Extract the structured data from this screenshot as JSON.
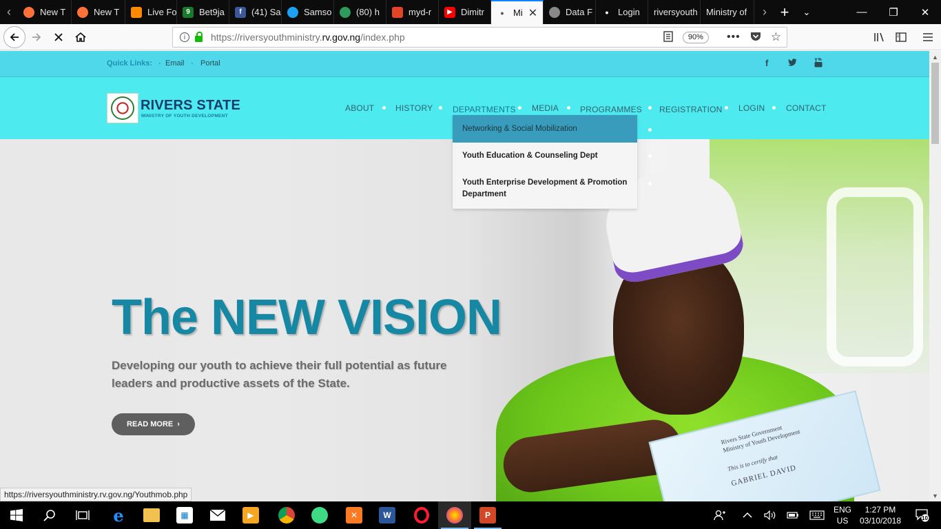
{
  "browser": {
    "tabs": [
      {
        "label": "New T",
        "icon": "firefox-icon",
        "color": "#ff7139"
      },
      {
        "label": "New T",
        "icon": "firefox-icon",
        "color": "#ff7139"
      },
      {
        "label": "Live Fo",
        "icon": "livescore-icon",
        "color": "#ff8a00"
      },
      {
        "label": "Bet9ja",
        "icon": "bet9ja-icon",
        "color": "#1a7a2c"
      },
      {
        "label": "(41) Sa",
        "icon": "facebook-icon",
        "color": "#3b5998"
      },
      {
        "label": "Samso",
        "icon": "twitter-icon",
        "color": "#1da1f2"
      },
      {
        "label": "(80) h",
        "icon": "chat-icon",
        "color": "#2e9b5d"
      },
      {
        "label": "myd-r",
        "icon": "gitlab-icon",
        "color": "#e24329"
      },
      {
        "label": "Dimitr",
        "icon": "youtube-icon",
        "color": "#ff0000"
      },
      {
        "label": "Mi",
        "icon": "loading-dot-icon",
        "color": "#f9f9fa"
      },
      {
        "label": "Data F",
        "icon": "crest-icon",
        "color": "#888888"
      },
      {
        "label": "Login",
        "icon": "loading-dot-icon",
        "color": "#0c0c0d"
      },
      {
        "label": "riversyouth",
        "icon": "",
        "color": "#0c0c0d"
      },
      {
        "label": "Ministry of",
        "icon": "",
        "color": "#0c0c0d"
      }
    ],
    "url_prefix": "https://riversyouthministry.",
    "url_host": "rv.gov.ng",
    "url_suffix": "/index.php",
    "zoom": "90%",
    "status_url": "https://riversyouthministry.rv.gov.ng/Youthmob.php"
  },
  "quickbar": {
    "label": "Quick Links:",
    "links": [
      "Email",
      "Portal"
    ],
    "social": {
      "facebook": "f",
      "twitter": "t",
      "youtube": "▶"
    }
  },
  "brand": {
    "title": "RIVERS STATE",
    "subtitle": "MINISTRY OF YOUTH DEVELOPMENT"
  },
  "nav": {
    "items": [
      "ABOUT",
      "HISTORY",
      "DEPARTMENTS",
      "MEDIA",
      "PROGRAMMES",
      "REGISTRATION",
      "LOGIN",
      "CONTACT"
    ]
  },
  "dropdown": {
    "items": [
      "Networking & Social Mobilization",
      "Youth Education & Counseling Dept",
      "Youth Enterprise Development & Promotion Department"
    ]
  },
  "hero": {
    "title": "The NEW VISION",
    "subtitle": "Developing our youth to achieve their full potential as future leaders and productive assets of the State.",
    "button": "READ MORE"
  },
  "certificate": {
    "line1": "Rivers State Government",
    "line2": "Ministry of Youth Development",
    "line3": "This is to certify that",
    "name": "GABRIEL DAVID"
  },
  "taskbar": {
    "lang_top": "ENG",
    "lang_bottom": "US",
    "time": "1:27 PM",
    "date": "03/10/2018",
    "notification_count": "10"
  },
  "colors": {
    "quickbar": "#4fd8ea",
    "header": "#4deaf0",
    "hero_title": "#1788a3",
    "dropdown_hover": "#3a9cbd"
  }
}
